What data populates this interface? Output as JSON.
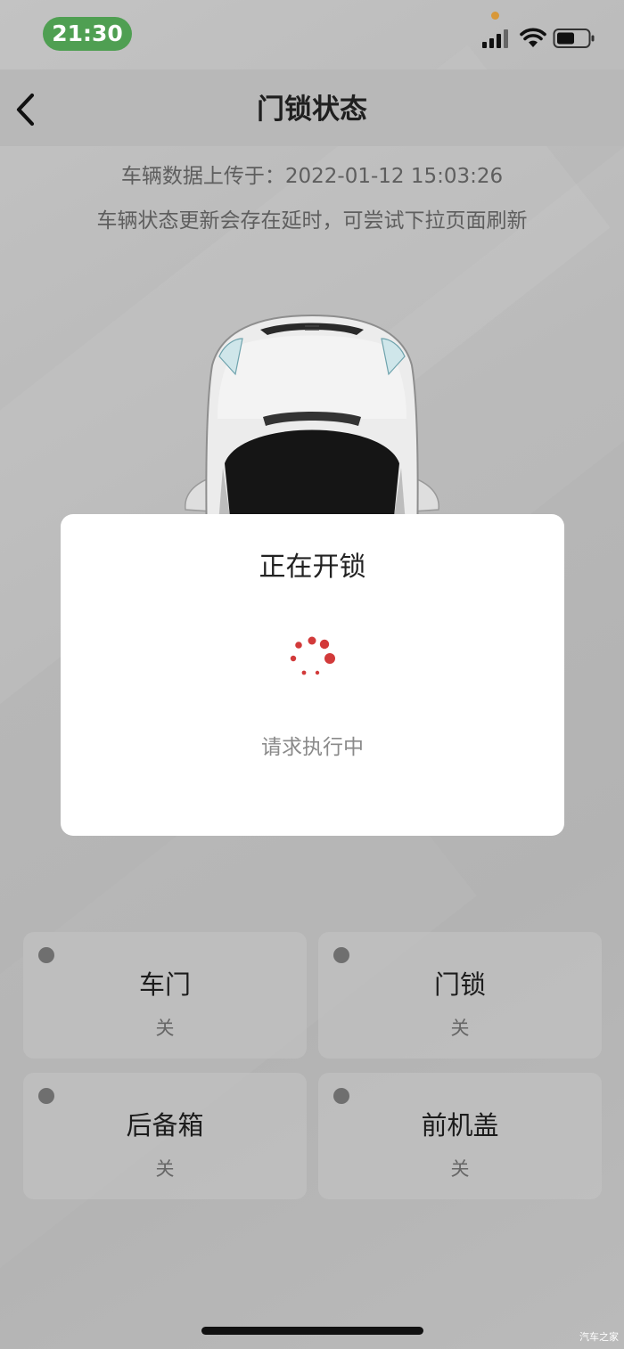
{
  "status_bar": {
    "time": "21:30",
    "icons": [
      "signal-icon",
      "wifi-icon",
      "battery-icon"
    ]
  },
  "nav": {
    "title": "门锁状态",
    "back_icon": "chevron-left-icon"
  },
  "info": {
    "upload_time": "车辆数据上传于：2022-01-12 15:03:26",
    "refresh_hint": "车辆状态更新会存在延时，可尝试下拉页面刷新"
  },
  "modal": {
    "title": "正在开锁",
    "status": "请求执行中",
    "spinner_color": "#d23a3a"
  },
  "cards": [
    {
      "label": "车门",
      "state": "关"
    },
    {
      "label": "门锁",
      "state": "关"
    },
    {
      "label": "后备箱",
      "state": "关"
    },
    {
      "label": "前机盖",
      "state": "关"
    }
  ],
  "watermark": "汽车之家",
  "colors": {
    "time_pill": "#4f9f52",
    "background": "#b8b8b8",
    "modal": "#ffffff",
    "card_dot": "#6f6f6f"
  }
}
